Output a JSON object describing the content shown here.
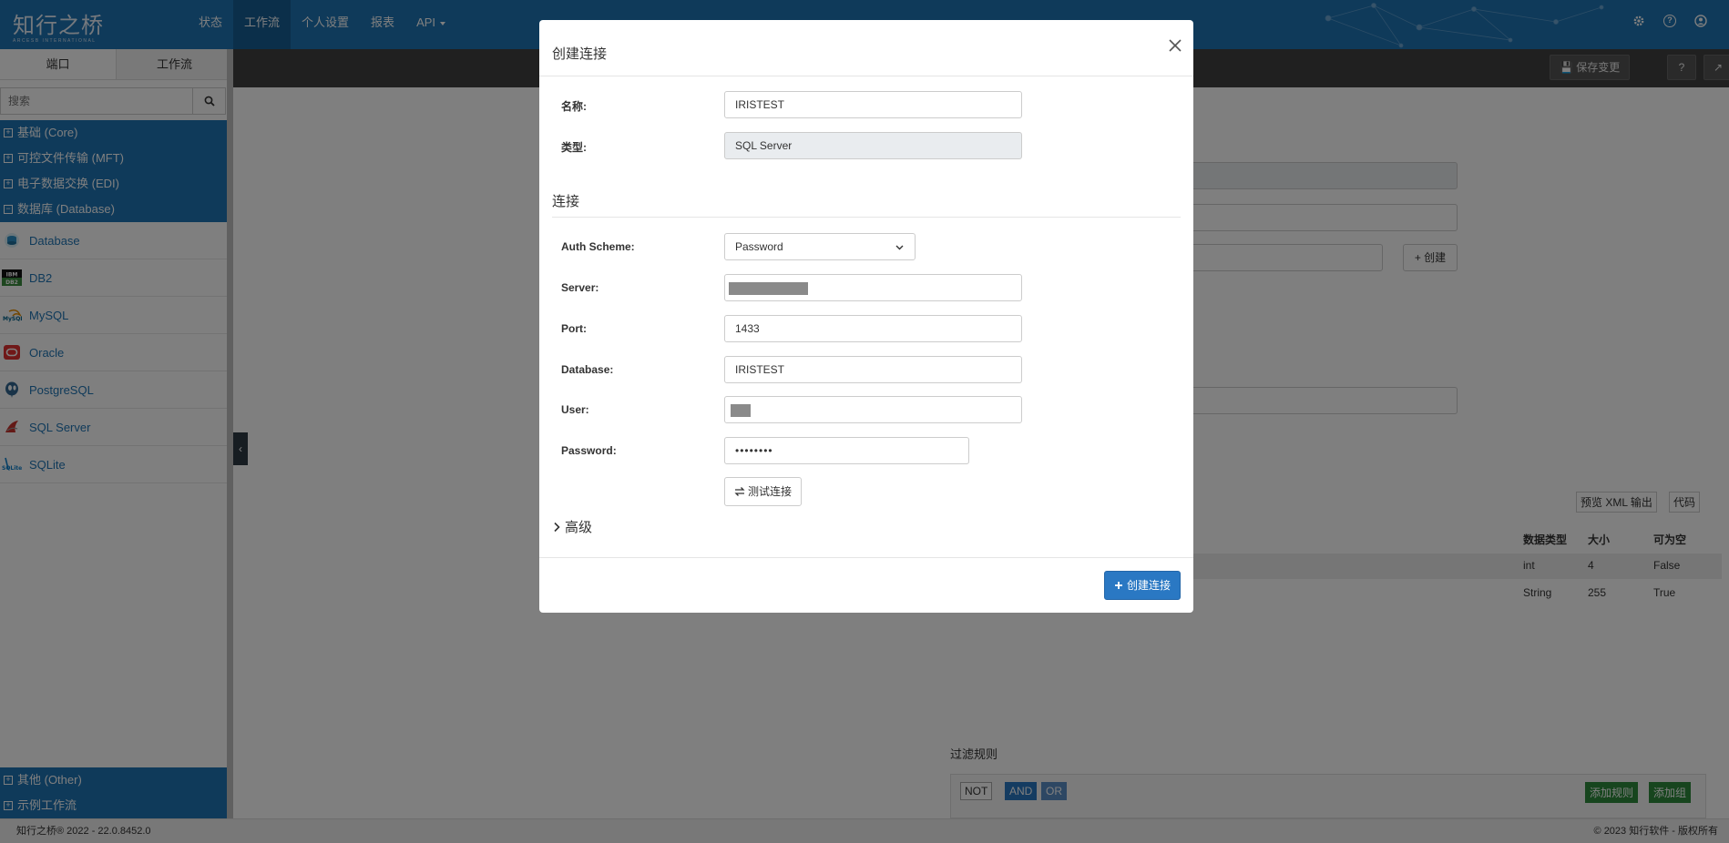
{
  "app": {
    "logo_text": "知行之桥",
    "logo_subtitle": "ARCESB INTERNATIONAL"
  },
  "nav": {
    "items": [
      {
        "label": "状态"
      },
      {
        "label": "工作流"
      },
      {
        "label": "个人设置"
      },
      {
        "label": "报表"
      },
      {
        "label": "API"
      }
    ],
    "icons": [
      "gear-icon",
      "help-icon",
      "user-icon"
    ]
  },
  "sidebar": {
    "tabs": [
      {
        "label": "端口"
      },
      {
        "label": "工作流"
      }
    ],
    "search_placeholder": "搜索",
    "categories_top": [
      {
        "label": "基础 (Core)"
      },
      {
        "label": "可控文件传输 (MFT)"
      },
      {
        "label": "电子数据交换 (EDI)"
      },
      {
        "label": "数据库 (Database)"
      }
    ],
    "connectors": [
      {
        "label": "Database"
      },
      {
        "label": "DB2"
      },
      {
        "label": "MySQL"
      },
      {
        "label": "Oracle"
      },
      {
        "label": "PostgreSQL"
      },
      {
        "label": "SQL Server"
      },
      {
        "label": "SQLite"
      }
    ],
    "categories_bottom": [
      {
        "label": "其他 (Other)"
      },
      {
        "label": "示例工作流"
      }
    ]
  },
  "background": {
    "save_label": "保存变更",
    "create_label": "+ 创建",
    "preview_label": "预览 XML 输出",
    "code_label": "代码",
    "table_headers": [
      "数据类型",
      "大小",
      "可为空"
    ],
    "table_rows": [
      [
        "int",
        "4",
        "False"
      ],
      [
        "String",
        "255",
        "True"
      ]
    ],
    "filter_title": "过滤规则",
    "filter_ops": [
      "NOT",
      "AND",
      "OR"
    ],
    "add_rule_label": "添加规则",
    "add_group_label": "添加组"
  },
  "footer": {
    "left": "知行之桥® 2022 - 22.0.8452.0",
    "right": "© 2023 知行软件 - 版权所有"
  },
  "modal": {
    "title": "创建连接",
    "name_label": "名称:",
    "name_value": "IRISTEST",
    "type_label": "类型:",
    "type_value": "SQL Server",
    "section_connection": "连接",
    "auth_label": "Auth Scheme:",
    "auth_value": "Password",
    "server_label": "Server:",
    "port_label": "Port:",
    "port_value": "1433",
    "database_label": "Database:",
    "database_value": "IRISTEST",
    "user_label": "User:",
    "password_label": "Password:",
    "password_value": "••••••••",
    "test_label": "测试连接",
    "advanced_label": "高级",
    "create_label": "创建连接"
  },
  "colors": {
    "brand": "#1f74b4",
    "primary_button": "#2a78c3",
    "success": "#2e8b3c"
  }
}
